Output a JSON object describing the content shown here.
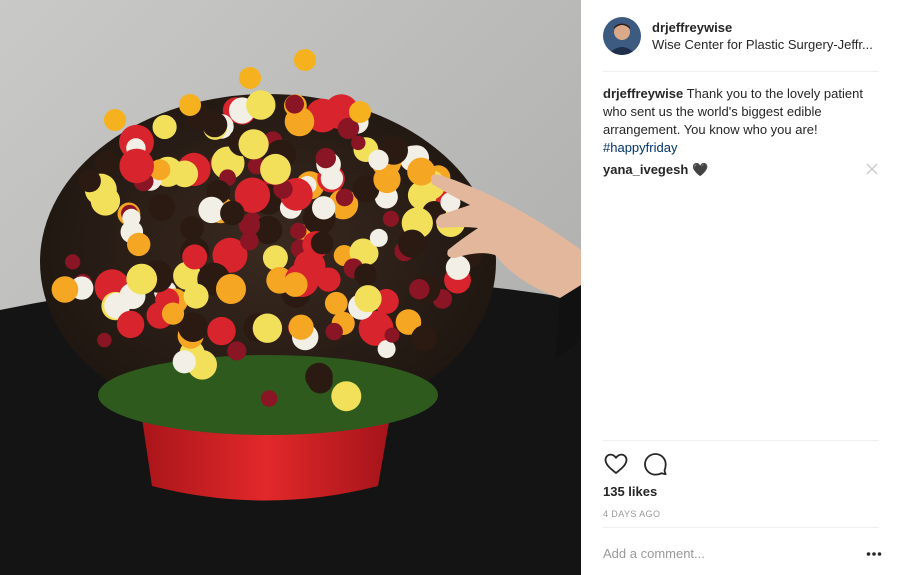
{
  "post": {
    "username": "drjeffreywise",
    "location": "Wise Center for Plastic Surgery-Jeffr...",
    "caption_user": "drjeffreywise",
    "caption_text": "Thank you to the lovely patient who sent us the world's biggest edible arrangement. You know who you are!",
    "hashtag": "#happyfriday",
    "comments": [
      {
        "user": "yana_ivegesh",
        "text": "🖤"
      }
    ],
    "likes": "135 likes",
    "age": "4 DAYS AGO",
    "comment_placeholder": "Add a comment..."
  },
  "icons": {
    "like": "heart-icon",
    "comment": "speech-bubble-icon",
    "more": "more-options-icon",
    "delete_comment": "close-icon"
  },
  "colors": {
    "text": "#262626",
    "muted": "#999999",
    "hashtag": "#003569",
    "divider": "#efefef",
    "basket": "#d4201f"
  }
}
